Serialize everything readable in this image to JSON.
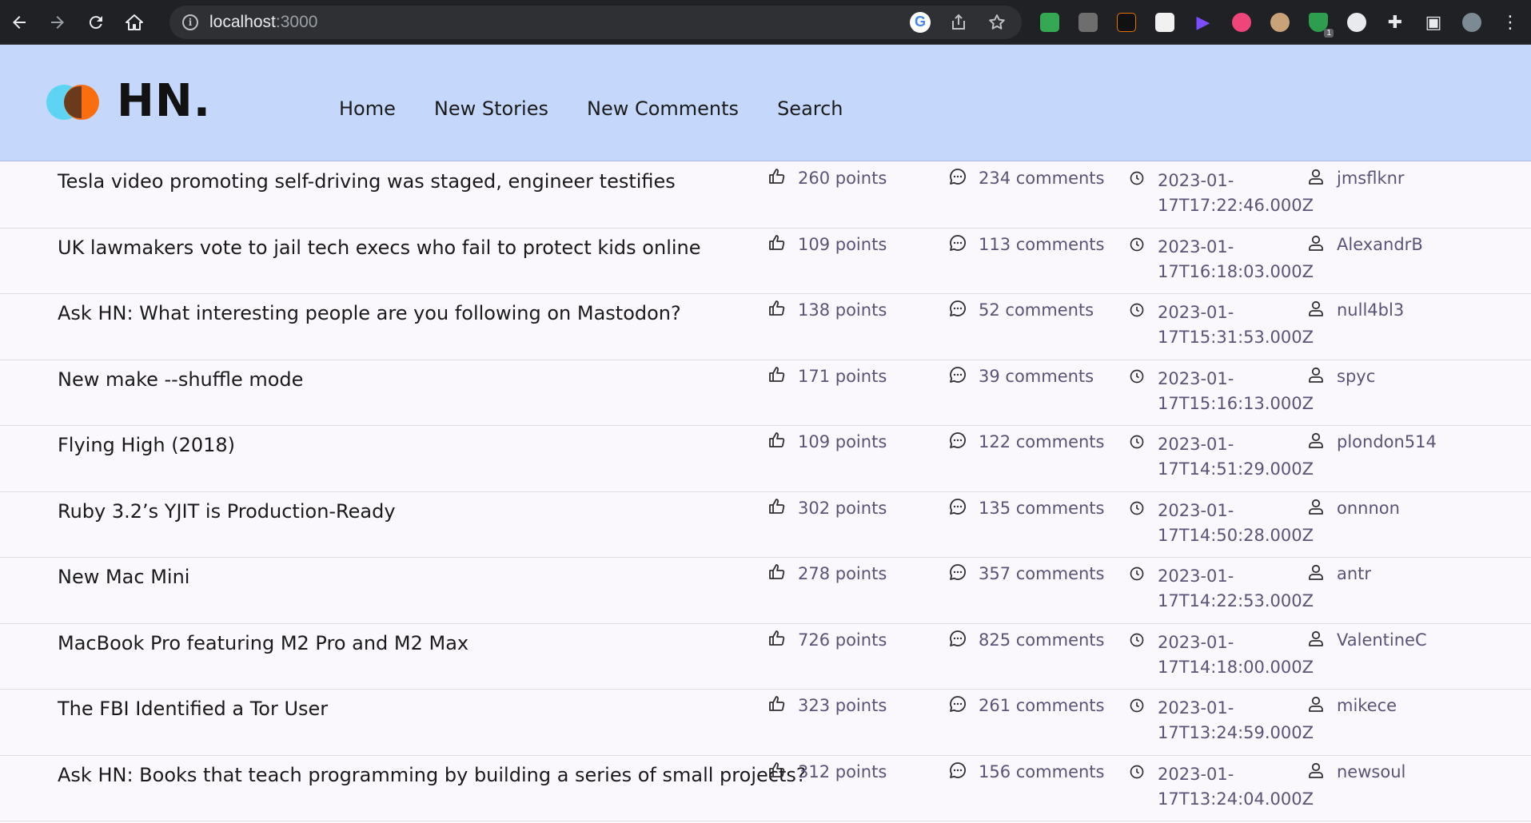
{
  "browser": {
    "url_host": "localhost",
    "url_port": ":3000"
  },
  "header": {
    "brand": "HN.",
    "nav": [
      "Home",
      "New Stories",
      "New Comments",
      "Search"
    ]
  },
  "stories": [
    {
      "title": "Tesla video promoting self-driving was staged, engineer testifies",
      "points": "260 points",
      "comments": "234 comments",
      "time_line1": "2023-01-",
      "time_line2": "17T17:22:46.000Z",
      "user": "jmsflknr"
    },
    {
      "title": "UK lawmakers vote to jail tech execs who fail to protect kids online",
      "points": "109 points",
      "comments": "113 comments",
      "time_line1": "2023-01-",
      "time_line2": "17T16:18:03.000Z",
      "user": "AlexandrB"
    },
    {
      "title": "Ask HN: What interesting people are you following on Mastodon?",
      "points": "138 points",
      "comments": "52 comments",
      "time_line1": "2023-01-",
      "time_line2": "17T15:31:53.000Z",
      "user": "null4bl3"
    },
    {
      "title": "New make --shuffle mode",
      "points": "171 points",
      "comments": "39 comments",
      "time_line1": "2023-01-",
      "time_line2": "17T15:16:13.000Z",
      "user": "spyc"
    },
    {
      "title": "Flying High (2018)",
      "points": "109 points",
      "comments": "122 comments",
      "time_line1": "2023-01-",
      "time_line2": "17T14:51:29.000Z",
      "user": "plondon514"
    },
    {
      "title": "Ruby 3.2’s YJIT is Production-Ready",
      "points": "302 points",
      "comments": "135 comments",
      "time_line1": "2023-01-",
      "time_line2": "17T14:50:28.000Z",
      "user": "onnnon"
    },
    {
      "title": "New Mac Mini",
      "points": "278 points",
      "comments": "357 comments",
      "time_line1": "2023-01-",
      "time_line2": "17T14:22:53.000Z",
      "user": "antr"
    },
    {
      "title": "MacBook Pro featuring M2 Pro and M2 Max",
      "points": "726 points",
      "comments": "825 comments",
      "time_line1": "2023-01-",
      "time_line2": "17T14:18:00.000Z",
      "user": "ValentineC"
    },
    {
      "title": "The FBI Identified a Tor User",
      "points": "323 points",
      "comments": "261 comments",
      "time_line1": "2023-01-",
      "time_line2": "17T13:24:59.000Z",
      "user": "mikece"
    },
    {
      "title": "Ask HN: Books that teach programming by building a series of small projects?",
      "points": "312 points",
      "comments": "156 comments",
      "time_line1": "2023-01-",
      "time_line2": "17T13:24:04.000Z",
      "user": "newsoul"
    }
  ],
  "icons": {
    "points": "thumbs-up-icon",
    "comments": "comment-bubble-icon",
    "time": "clock-icon",
    "user": "user-icon"
  },
  "colors": {
    "header_bg": "#c5d8fc",
    "meta_text": "#5a5478",
    "logo_blue": "#5fd3f3",
    "logo_orange": "#fb6e10"
  }
}
